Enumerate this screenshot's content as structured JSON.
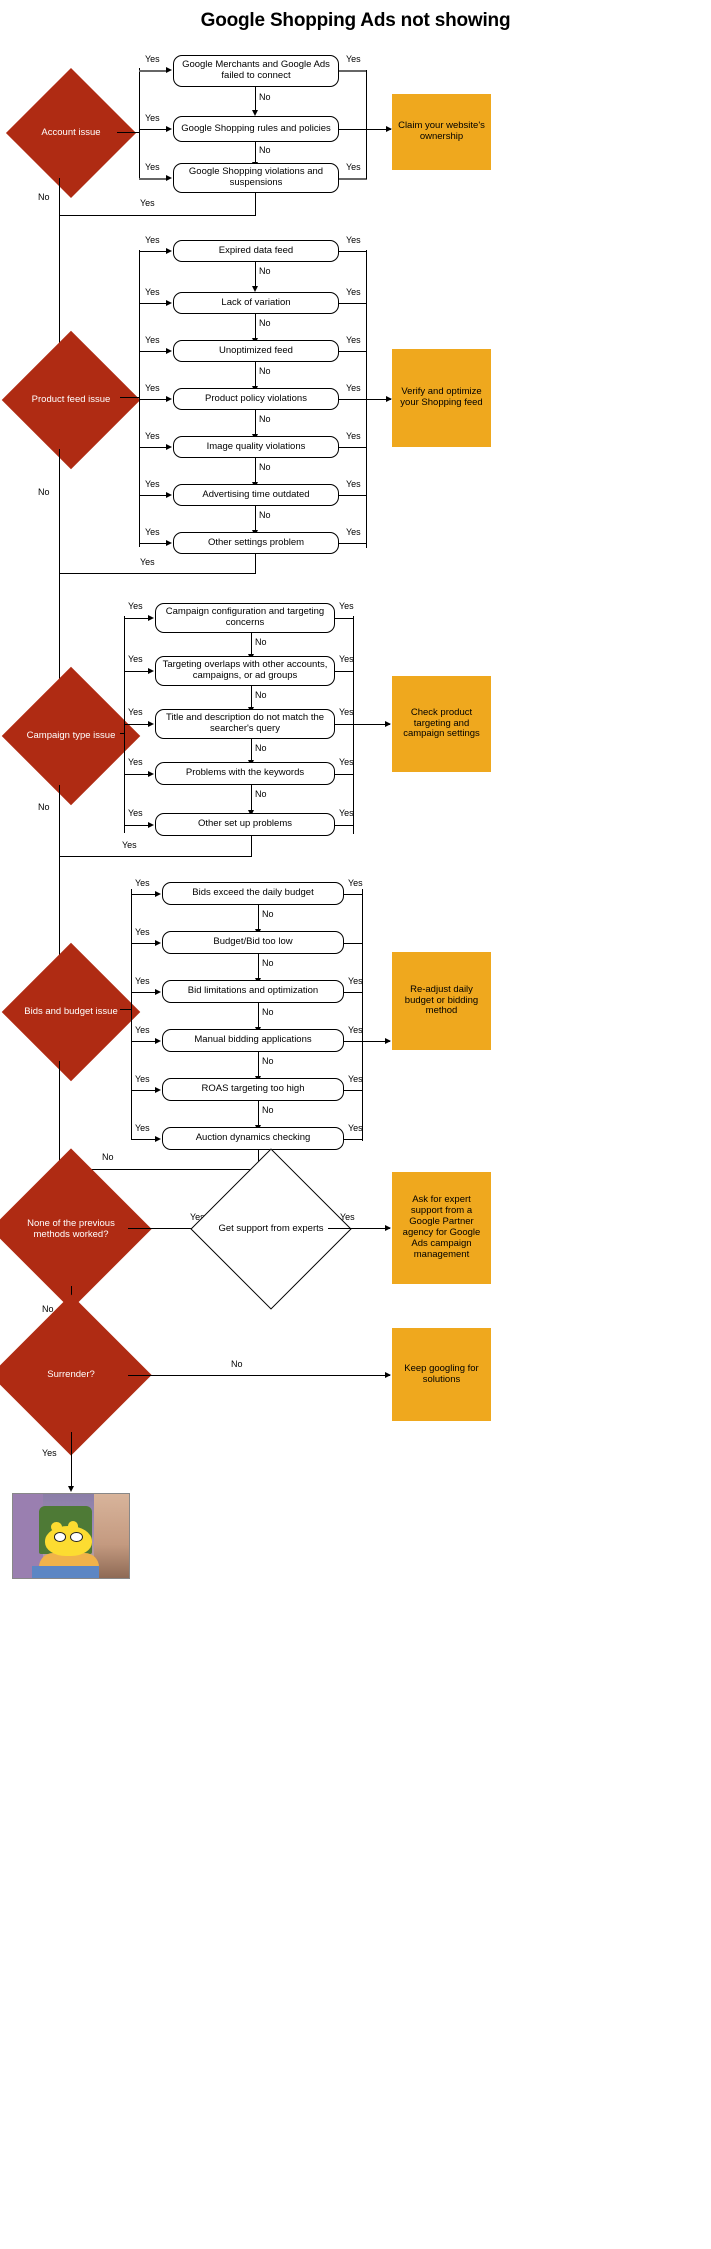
{
  "title": "Google Shopping Ads not showing",
  "labels": {
    "yes": "Yes",
    "no": "No"
  },
  "colors": {
    "decision_red": "#af2b13",
    "outcome_orange": "#efa81e",
    "node_border": "#000000",
    "edge": "#000000",
    "edge_gray": "#666666",
    "background": "#ffffff"
  },
  "sections": [
    {
      "id": "account",
      "decision": "Account issue",
      "outcome": "Claim your website's ownership",
      "items": [
        "Google Merchants and Google Ads failed to connect",
        "Google Shopping rules and policies",
        "Google Shopping violations and suspensions"
      ]
    },
    {
      "id": "product-feed",
      "decision": "Product feed issue",
      "outcome": "Verify and optimize your Shopping feed",
      "items": [
        "Expired data feed",
        "Lack of variation",
        "Unoptimized feed",
        "Product policy violations",
        "Image quality violations",
        "Advertising time outdated",
        "Other settings problem"
      ]
    },
    {
      "id": "campaign-type",
      "decision": "Campaign type issue",
      "outcome": "Check product targeting and campaign settings",
      "items": [
        "Campaign configuration and targeting concerns",
        "Targeting overlaps with other accounts, campaigns, or ad groups",
        "Title and description do not match the searcher's query",
        "Problems with the keywords",
        "Other set up problems"
      ]
    },
    {
      "id": "bids-budget",
      "decision": "Bids and budget issue",
      "outcome": "Re-adjust daily budget or bidding method",
      "items": [
        "Bids exceed the daily budget",
        "Budget/Bid too low",
        "Bid limitations and optimization",
        "Manual bidding applications",
        "ROAS targeting too high",
        "Auction dynamics checking"
      ]
    }
  ],
  "tail": {
    "none_worked_decision": "None of the previous methods worked?",
    "support_node": "Get support from experts",
    "support_outcome": "Ask for expert support from a Google Partner agency for Google Ads campaign management",
    "surrender_decision": "Surrender?",
    "surrender_outcome": "Keep googling for solutions",
    "final_image_alt": "homer-simpson-hedge-image"
  }
}
